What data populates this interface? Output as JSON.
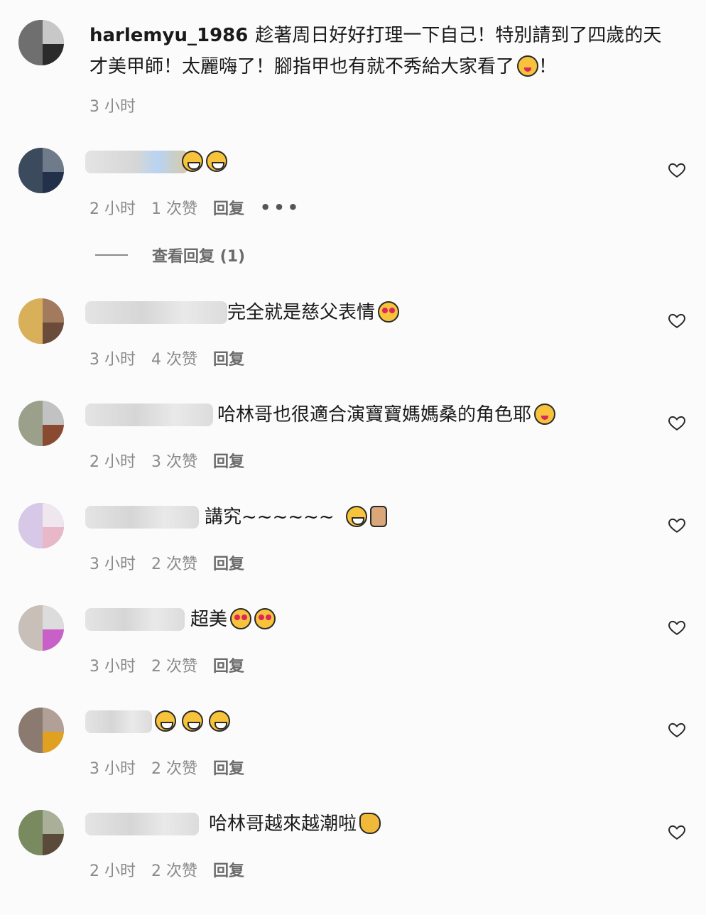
{
  "post": {
    "username": "harlemyu_1986",
    "text": "趁著周日好好打理一下自己！特別請到了四歲的天才美甲師！太麗嗨了！腳指甲也有就不秀給大家看了",
    "text_end": "！",
    "time": "3 小时",
    "emoji_icon": "zany-face-emoji"
  },
  "view_replies": "查看回复 (1)",
  "comments": [
    {
      "text": "",
      "emojis": [
        "joy-emoji",
        "joy-emoji"
      ],
      "time": "2 小时",
      "likes": "1 次赞",
      "reply": "回复",
      "more": "•••"
    },
    {
      "text": "完全就是慈父表情",
      "emojis": [
        "heart-eyes-emoji"
      ],
      "time": "3 小时",
      "likes": "4 次赞",
      "reply": "回复"
    },
    {
      "text": "哈林哥也很適合演寶寶媽媽桑的角色耶",
      "emojis": [
        "zany-face-emoji"
      ],
      "time": "2 小时",
      "likes": "3 次赞",
      "reply": "回复"
    },
    {
      "text": "講究~~~~~~",
      "emojis": [
        "joy-emoji",
        "horns-hand-emoji"
      ],
      "time": "3 小时",
      "likes": "2 次赞",
      "reply": "回复"
    },
    {
      "text": "超美",
      "emojis": [
        "heart-eyes-emoji",
        "heart-eyes-emoji"
      ],
      "time": "3 小时",
      "likes": "2 次赞",
      "reply": "回复"
    },
    {
      "text": "",
      "emojis": [
        "joy-emoji",
        "joy-emoji",
        "joy-emoji"
      ],
      "time": "3 小时",
      "likes": "2 次赞",
      "reply": "回复"
    },
    {
      "text": "哈林哥越來越潮啦",
      "emojis": [
        "clap-emoji"
      ],
      "time": "2 小时",
      "likes": "2 次赞",
      "reply": "回复"
    }
  ],
  "colors": {
    "meta": "#8a8a8a",
    "text": "#1a1a1a",
    "background": "#fbfbfb"
  }
}
